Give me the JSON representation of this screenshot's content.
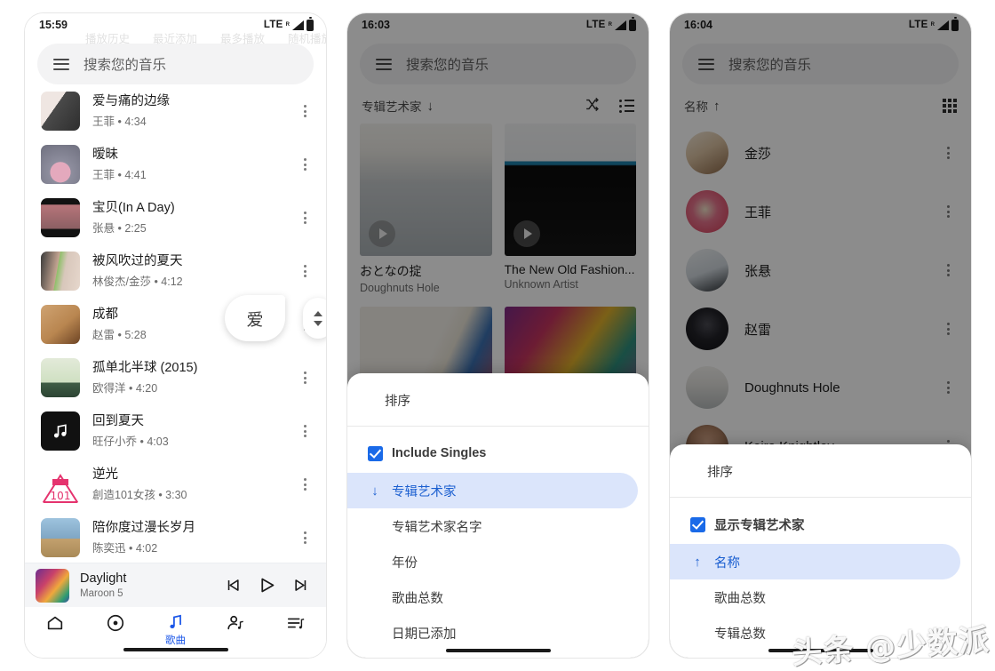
{
  "phones": [
    {
      "id": "songs",
      "status": {
        "time": "15:59",
        "network": "LTE",
        "roaming": "R"
      },
      "ghost_tabs": [
        "播放历史",
        "最近添加",
        "最多播放",
        "随机播放"
      ],
      "search": {
        "placeholder": "搜索您的音乐"
      },
      "fast_scroll": {
        "letter": "爱"
      },
      "songs": [
        {
          "title": "爱与痛的边缘",
          "artist": "王菲",
          "duration": "4:34",
          "sub": "王菲 • 4:34",
          "c1": "#efe6e2",
          "c2": "#4a4a4a"
        },
        {
          "title": "暧昧",
          "artist": "王菲",
          "duration": "4:41",
          "sub": "王菲 • 4:41",
          "c1": "#8e8e9e",
          "c2": "#e4a9bd"
        },
        {
          "title": "宝贝(In A Day)",
          "artist": "张悬",
          "duration": "2:25",
          "sub": "张悬 • 2:25",
          "c1": "#121212",
          "c2": "#b7757a"
        },
        {
          "title": "被风吹过的夏天",
          "artist": "林俊杰/金莎",
          "duration": "4:12",
          "sub": "林俊杰/金莎 • 4:12",
          "c1": "#d8c7bb",
          "c2": "#8fbf6a"
        },
        {
          "title": "成都",
          "artist": "赵雷",
          "duration": "5:28",
          "sub": "赵雷 • 5:28",
          "c1": "#cfa372",
          "c2": "#8a5a2b"
        },
        {
          "title": "孤单北半球 (2015)",
          "artist": "欧得洋",
          "duration": "4:20",
          "sub": "欧得洋 • 4:20",
          "c1": "#dbe5cf",
          "c2": "#3f5d45"
        },
        {
          "title": "回到夏天",
          "artist": "旺仔小乔",
          "duration": "4:03",
          "sub": "旺仔小乔 • 4:03",
          "c1": "#111111",
          "c2": "#111111"
        },
        {
          "title": "逆光",
          "artist": "創造101女孩",
          "duration": "3:30",
          "sub": "創造101女孩 • 3:30",
          "c1": "#ffffff",
          "c2": "#e5336e"
        },
        {
          "title": "陪你度过漫长岁月",
          "artist": "陈奕迅",
          "duration": "4:02",
          "sub": "陈奕迅 • 4:02",
          "c1": "#7fa6c4",
          "c2": "#c2a06d"
        }
      ],
      "player": {
        "title": "Daylight",
        "artist": "Maroon 5"
      },
      "nav": [
        {
          "label": "",
          "icon": "home-icon",
          "active": false
        },
        {
          "label": "",
          "icon": "album-disc-icon",
          "active": false
        },
        {
          "label": "歌曲",
          "icon": "music-note-icon",
          "active": true
        },
        {
          "label": "",
          "icon": "artist-icon",
          "active": false
        },
        {
          "label": "",
          "icon": "playlist-icon",
          "active": false
        }
      ],
      "accent": "#1a56e8"
    },
    {
      "id": "albums",
      "status": {
        "time": "16:03",
        "network": "LTE",
        "roaming": "R"
      },
      "search": {
        "placeholder": "搜索您的音乐"
      },
      "sort": {
        "label": "专辑艺术家",
        "direction": "↓"
      },
      "albums": [
        {
          "title": "おとなの掟",
          "artist": "Doughnuts Hole",
          "c1": "#e9e9e6",
          "c2": "#b9bdbe"
        },
        {
          "title": "The New Old Fashion...",
          "artist": "Unknown Artist",
          "c1": "#0a0a0a",
          "c2": "#1d7ea8"
        },
        {
          "title": "",
          "artist": "",
          "c1": "#f0ece4",
          "c2": "#d6433f"
        },
        {
          "title": "",
          "artist": "",
          "c1": "#8a2f7a",
          "c2": "#e0b02a"
        }
      ],
      "sheet": {
        "title": "排序",
        "checkbox": {
          "label": "Include Singles",
          "checked": true
        },
        "options": [
          {
            "label": "专辑艺术家",
            "selected": true,
            "arrow": "↓"
          },
          {
            "label": "专辑艺术家名字",
            "selected": false,
            "arrow": ""
          },
          {
            "label": "年份",
            "selected": false,
            "arrow": ""
          },
          {
            "label": "歌曲总数",
            "selected": false,
            "arrow": ""
          },
          {
            "label": "日期已添加",
            "selected": false,
            "arrow": ""
          }
        ]
      }
    },
    {
      "id": "artists",
      "status": {
        "time": "16:04",
        "network": "LTE",
        "roaming": "R"
      },
      "search": {
        "placeholder": "搜索您的音乐"
      },
      "sort": {
        "label": "名称",
        "direction": "↑"
      },
      "artists": [
        {
          "name": "金莎",
          "c1": "#e8d9c6",
          "c2": "#a37b56"
        },
        {
          "name": "王菲",
          "c1": "#d43a55",
          "c2": "#f0e2c8"
        },
        {
          "name": "张悬",
          "c1": "#d8dde2",
          "c2": "#2e3338"
        },
        {
          "name": "赵雷",
          "c1": "#16161a",
          "c2": "#3a3a42"
        },
        {
          "name": "Doughnuts Hole",
          "c1": "#e7e7e4",
          "c2": "#b6babb"
        },
        {
          "name": "Keira Knightley",
          "c1": "#bb8f76",
          "c2": "#3b2a22"
        }
      ],
      "sheet": {
        "title": "排序",
        "checkbox": {
          "label": "显示专辑艺术家",
          "checked": true
        },
        "options": [
          {
            "label": "名称",
            "selected": true,
            "arrow": "↑"
          },
          {
            "label": "歌曲总数",
            "selected": false,
            "arrow": ""
          },
          {
            "label": "专辑总数",
            "selected": false,
            "arrow": ""
          }
        ]
      }
    }
  ],
  "watermark": {
    "text": "头条 @少数派"
  }
}
